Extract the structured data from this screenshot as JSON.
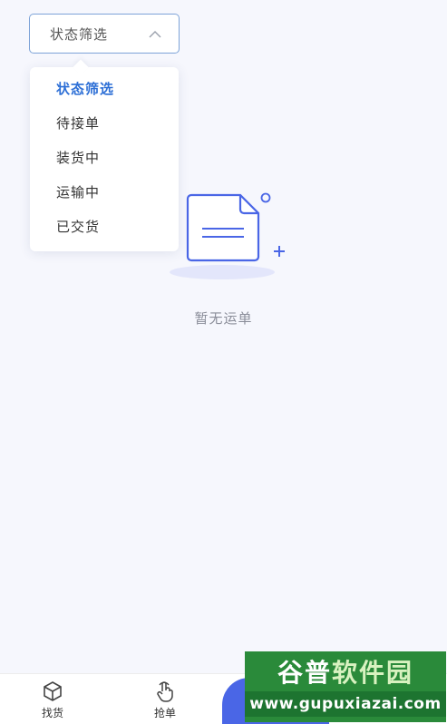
{
  "filter": {
    "selected_label": "状态筛选",
    "options": [
      "状态筛选",
      "待接单",
      "装货中",
      "运输中",
      "已交货"
    ],
    "active_index": 0
  },
  "empty_state": {
    "message": "暂无运单",
    "icon": "document-icon"
  },
  "bottom_nav": {
    "items": [
      {
        "label": "找货",
        "icon": "box-icon"
      },
      {
        "label": "抢单",
        "icon": "hand-tap-icon"
      }
    ]
  },
  "watermark": {
    "title_part1": "谷普",
    "title_part2": "软件园",
    "url": "www.gupuxiazai.com"
  },
  "colors": {
    "accent": "#2d6fd6",
    "border": "#7da3d8",
    "illustration": "#4a66e6",
    "watermark": "#2a8a3a"
  }
}
